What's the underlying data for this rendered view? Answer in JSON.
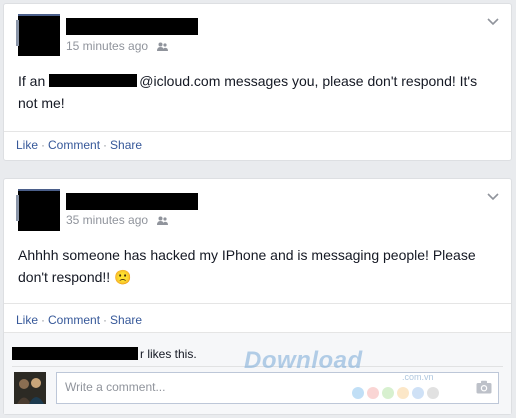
{
  "posts": [
    {
      "time": "15 minutes ago",
      "text_before": "If an",
      "text_after": "@icloud.com messages you, please don't respond! It's not me!",
      "actions": {
        "like": "Like",
        "comment": "Comment",
        "share": "Share",
        "sep": "·"
      }
    },
    {
      "time": "35 minutes ago",
      "text": "Ahhhh someone has hacked my IPhone and is messaging people! Please don't respond!! ",
      "emoji": "🙁",
      "actions": {
        "like": "Like",
        "comment": "Comment",
        "share": "Share",
        "sep": "·"
      },
      "likes_text": "r likes this.",
      "comment_placeholder": "Write a comment..."
    }
  ],
  "watermark": {
    "text": "Download",
    "sub": ".com.vn"
  },
  "icons": [
    "audience-friends-icon",
    "chevron-down-icon",
    "camera-icon"
  ],
  "colors": {
    "link": "#365899",
    "meta": "#90949c",
    "background": "#e9ebee",
    "watermark_dots": [
      "#8ec5ef",
      "#f5b3b0",
      "#b7e3a8",
      "#f9d49b",
      "#a7c8ef",
      "#c9c9c9"
    ]
  }
}
